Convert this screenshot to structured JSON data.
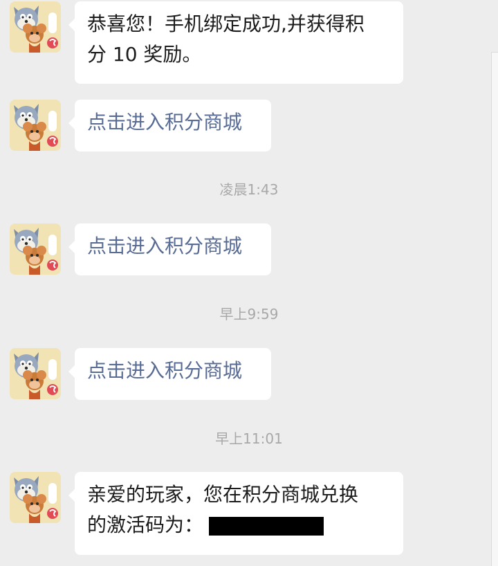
{
  "messages": [
    {
      "type": "text",
      "line1": "恭喜您！手机绑定成功,并获得积",
      "line2": "分 10 奖励。"
    },
    {
      "type": "link",
      "text": "点击进入积分商城"
    },
    {
      "type": "time",
      "text": "凌晨1:43"
    },
    {
      "type": "link",
      "text": "点击进入积分商城"
    },
    {
      "type": "time",
      "text": "早上9:59"
    },
    {
      "type": "link",
      "text": "点击进入积分商城"
    },
    {
      "type": "time",
      "text": "早上11:01"
    },
    {
      "type": "text",
      "line1": "亲爱的玩家，您在积分商城兑换",
      "line2": "的激活码为："
    }
  ],
  "avatar_icon": "tom-and-jerry-game-icon",
  "colors": {
    "background": "#ededed",
    "bubble": "#ffffff",
    "link": "#576b95",
    "time": "#a8a8a8",
    "text": "#1b1b1b"
  }
}
